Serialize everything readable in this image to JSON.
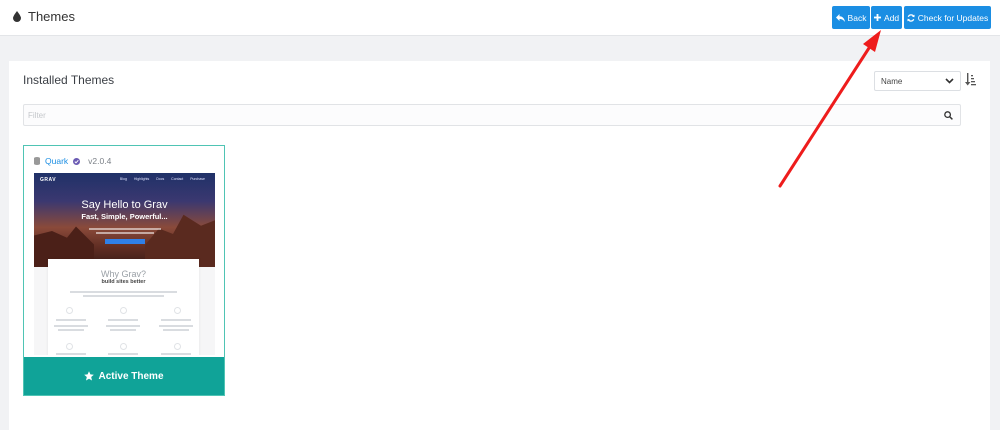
{
  "header": {
    "title": "Themes",
    "title_icon": "droplet-icon",
    "buttons": {
      "back": "Back",
      "add": "Add",
      "check_updates": "Check for Updates"
    }
  },
  "panel": {
    "title": "Installed Themes",
    "sort": {
      "selected": "Name"
    },
    "filter": {
      "placeholder": "Filter"
    }
  },
  "themes": [
    {
      "name": "Quark",
      "version": "v2.0.4",
      "status": "Active Theme",
      "preview": {
        "logo": "GRAV",
        "nav": "Blog Highlights Docs Contact Purchase",
        "headline": "Say Hello to Grav",
        "subheadline": "Fast, Simple, Powerful...",
        "section_title": "Why Grav?",
        "section_subtitle": "build sites better"
      }
    }
  ],
  "colors": {
    "primary": "#1b8ee3",
    "active": "#10a398",
    "card_border": "#4fc4b4",
    "annotation_arrow": "#ee1c1c"
  },
  "annotation": {
    "type": "arrow",
    "target": "add-button",
    "color": "red"
  }
}
